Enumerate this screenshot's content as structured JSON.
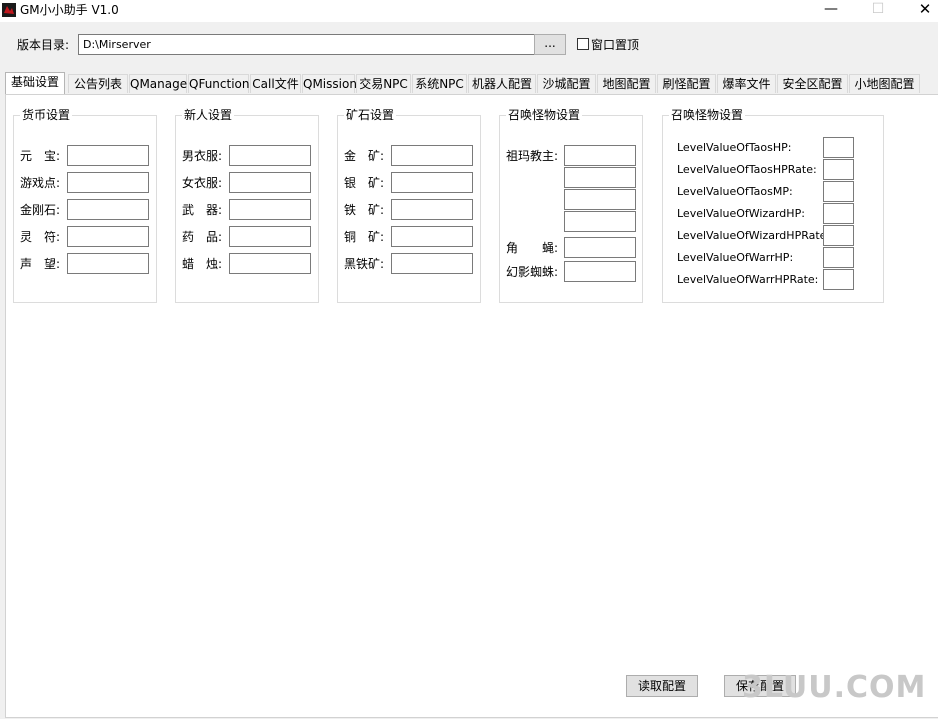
{
  "window": {
    "title": "GM小小助手 V1.0",
    "minimize_glyph": "—",
    "maximize_glyph": "☐",
    "close_glyph": "✕",
    "icon": "app-logo-icon",
    "accent_color": "#c0181e"
  },
  "toolbar": {
    "dir_label": "版本目录:",
    "dir_value": "D:\\Mirserver",
    "browse_label": "...",
    "topmost_label": "窗口置顶",
    "topmost_checked": false
  },
  "tabs": [
    {
      "label": "基础设置",
      "active": true
    },
    {
      "label": "公告列表"
    },
    {
      "label": "QManage"
    },
    {
      "label": "QFunction"
    },
    {
      "label": "Call文件"
    },
    {
      "label": "QMission"
    },
    {
      "label": "交易NPC"
    },
    {
      "label": "系统NPC"
    },
    {
      "label": "机器人配置"
    },
    {
      "label": "沙城配置"
    },
    {
      "label": "地图配置"
    },
    {
      "label": "刷怪配置"
    },
    {
      "label": "爆率文件"
    },
    {
      "label": "安全区配置"
    },
    {
      "label": "小地图配置"
    }
  ],
  "groups": {
    "currency": {
      "title": "货币设置",
      "fields": [
        {
          "label": "元　宝:",
          "value": ""
        },
        {
          "label": "游戏点:",
          "value": ""
        },
        {
          "label": "金刚石:",
          "value": ""
        },
        {
          "label": "灵　符:",
          "value": ""
        },
        {
          "label": "声　望:",
          "value": ""
        }
      ]
    },
    "newbie": {
      "title": "新人设置",
      "fields": [
        {
          "label": "男衣服:",
          "value": ""
        },
        {
          "label": "女衣服:",
          "value": ""
        },
        {
          "label": "武　器:",
          "value": ""
        },
        {
          "label": "药　品:",
          "value": ""
        },
        {
          "label": "蜡　烛:",
          "value": ""
        }
      ]
    },
    "ore": {
      "title": "矿石设置",
      "fields": [
        {
          "label": "金　矿:",
          "value": ""
        },
        {
          "label": "银　矿:",
          "value": ""
        },
        {
          "label": "铁　矿:",
          "value": ""
        },
        {
          "label": "铜　矿:",
          "value": ""
        },
        {
          "label": "黑铁矿:",
          "value": ""
        }
      ]
    },
    "summon_monsters": {
      "title": "召唤怪物设置",
      "zuma_label": "祖玛教主:",
      "jiaowei_label": "角　　蝇:",
      "spider_label": "幻影蜘蛛:"
    },
    "summon_levels": {
      "title": "召唤怪物设置",
      "fields": [
        {
          "label": "LevelValueOfTaosHP:",
          "value": ""
        },
        {
          "label": "LevelValueOfTaosHPRate:",
          "value": ""
        },
        {
          "label": "LevelValueOfTaosMP:",
          "value": ""
        },
        {
          "label": "LevelValueOfWizardHP:",
          "value": ""
        },
        {
          "label": "LevelValueOfWizardHPRate:",
          "value": ""
        },
        {
          "label": "LevelValueOfWarrHP:",
          "value": ""
        },
        {
          "label": "LevelValueOfWarrHPRate:",
          "value": ""
        }
      ]
    }
  },
  "actions": {
    "load_label": "读取配置",
    "save_label": "保存配置"
  },
  "watermark": "3LUU.COM"
}
